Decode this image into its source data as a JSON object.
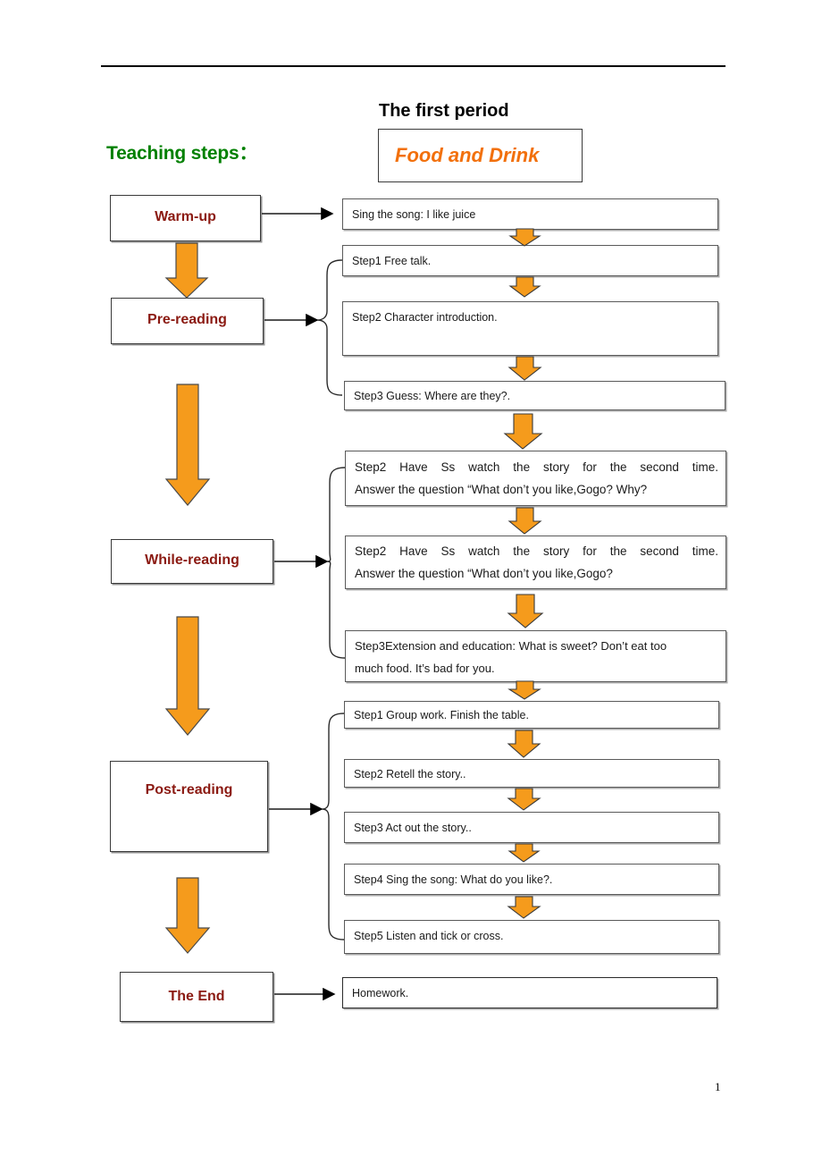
{
  "document": {
    "page_number": "1"
  },
  "header": {
    "section_label": "Teaching steps：",
    "period_title": "The first period",
    "lesson_title": "Food and Drink"
  },
  "colors": {
    "stage_text": "#8B1A12",
    "teaching_steps_green": "#008000",
    "lesson_title_orange": "#F2700C",
    "arrow_orange": "#F59B1C",
    "box_border": "#5a5a5a"
  },
  "stages": [
    {
      "id": "warm-up",
      "label": "Warm-up"
    },
    {
      "id": "pre-reading",
      "label": "Pre-reading"
    },
    {
      "id": "while-reading",
      "label": "While-reading"
    },
    {
      "id": "post-reading",
      "label": "Post-reading"
    },
    {
      "id": "the-end",
      "label": "The End"
    }
  ],
  "steps": {
    "warm_up": [
      {
        "text": "Sing the song: I like juice"
      }
    ],
    "pre_reading": [
      {
        "text": "Step1 Free talk."
      },
      {
        "text": "Step2 Character introduction."
      },
      {
        "text": "Step3 Guess: Where are they?."
      }
    ],
    "while_reading": [
      {
        "line1": "Step2 Have Ss watch the story for the second time.",
        "line2": "Answer the question “What don’t you like,Gogo? Why?"
      },
      {
        "line1": "Step2 Have Ss watch the story for the second time.",
        "line2": "Answer the question “What don’t you like,Gogo?"
      },
      {
        "line1": "Step3Extension and education: What is sweet? Don’t eat too",
        "line2": "much food. It’s bad for you."
      }
    ],
    "post_reading": [
      {
        "text": "Step1 Group work. Finish the table."
      },
      {
        "text": "Step2 Retell the story.."
      },
      {
        "text": " Step3 Act out the story.."
      },
      {
        "text": "Step4 Sing the song: What do you like?."
      },
      {
        "text": "Step5 Listen and tick or cross."
      }
    ],
    "the_end": [
      {
        "text": "Homework."
      }
    ]
  }
}
